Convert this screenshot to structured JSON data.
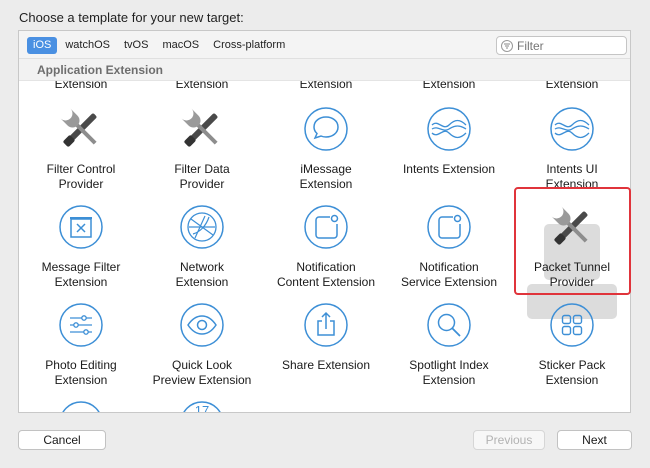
{
  "heading": "Choose a template for your new target:",
  "platform_tabs": [
    "iOS",
    "watchOS",
    "tvOS",
    "macOS",
    "Cross-platform"
  ],
  "active_tab": "iOS",
  "filter": {
    "placeholder": "Filter"
  },
  "section_title": "Application Extension",
  "partial_row_labels": [
    "Extension",
    "Extension",
    "Extension",
    "Extension",
    "Extension"
  ],
  "templates": [
    {
      "label": "Filter Control Provider",
      "line1": "Filter Control",
      "line2": "Provider",
      "icon": "wrench-screwdriver-icon"
    },
    {
      "label": "Filter Data Provider",
      "line1": "Filter Data",
      "line2": "Provider",
      "icon": "wrench-screwdriver-icon"
    },
    {
      "label": "iMessage Extension",
      "line1": "iMessage",
      "line2": "Extension",
      "icon": "speech-bubble-icon"
    },
    {
      "label": "Intents Extension",
      "line1": "Intents Extension",
      "line2": "",
      "icon": "intents-waves-icon"
    },
    {
      "label": "Intents UI Extension",
      "line1": "Intents UI",
      "line2": "Extension",
      "icon": "intents-waves-icon"
    },
    {
      "label": "Message Filter Extension",
      "line1": "Message Filter",
      "line2": "Extension",
      "icon": "filter-box-icon"
    },
    {
      "label": "Network Extension",
      "line1": "Network",
      "line2": "Extension",
      "icon": "globe-network-icon"
    },
    {
      "label": "Notification Content Extension",
      "line1": "Notification",
      "line2": "Content Extension",
      "icon": "notification-badge-icon"
    },
    {
      "label": "Notification Service Extension",
      "line1": "Notification",
      "line2": "Service Extension",
      "icon": "notification-badge-icon"
    },
    {
      "label": "Packet Tunnel Provider",
      "line1": "Packet Tunnel",
      "line2": "Provider",
      "icon": "wrench-screwdriver-icon",
      "selected": true
    },
    {
      "label": "Photo Editing Extension",
      "line1": "Photo Editing",
      "line2": "Extension",
      "icon": "sliders-icon"
    },
    {
      "label": "Quick Look Preview Extension",
      "line1": "Quick Look",
      "line2": "Preview Extension",
      "icon": "eye-icon"
    },
    {
      "label": "Share Extension",
      "line1": "Share Extension",
      "line2": "",
      "icon": "share-icon"
    },
    {
      "label": "Spotlight Index Extension",
      "line1": "Spotlight Index",
      "line2": "Extension",
      "icon": "magnifier-icon"
    },
    {
      "label": "Sticker Pack Extension",
      "line1": "Sticker Pack",
      "line2": "Extension",
      "icon": "sticker-grid-icon"
    }
  ],
  "partial_bottom_icons": [
    "keyboard-box-icon",
    "calendar-icon"
  ],
  "calendar_number": "17",
  "buttons": {
    "cancel": "Cancel",
    "previous": "Previous",
    "next": "Next"
  },
  "colors": {
    "accent": "#4a90e2",
    "selection_border": "#e0343b",
    "icon_blue": "#3d8fd6"
  }
}
